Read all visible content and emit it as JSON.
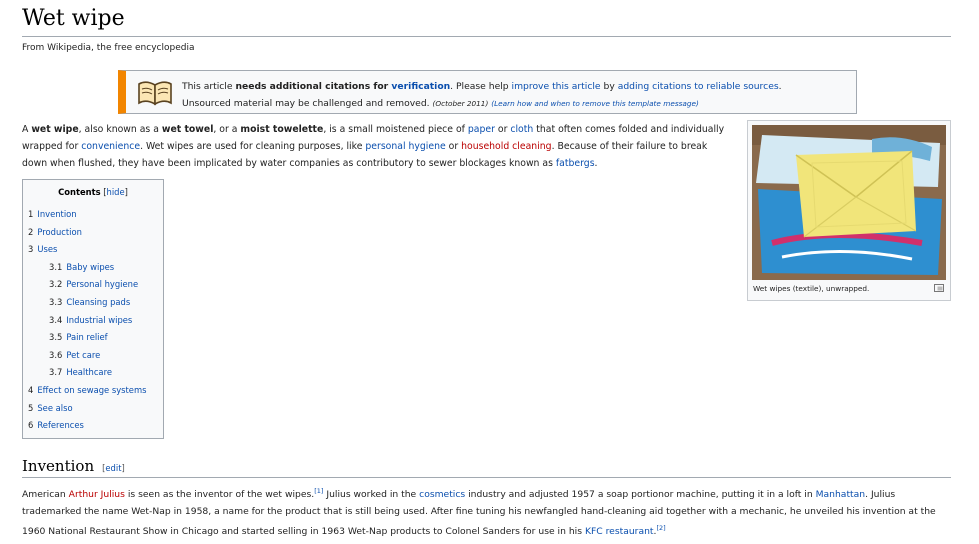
{
  "page": {
    "title": "Wet wipe",
    "tagline": "From Wikipedia, the free encyclopedia"
  },
  "ambox": {
    "icon": "book-icon",
    "t1": "This article ",
    "t2": "needs additional citations for ",
    "t3": "verification",
    "t4": ". Please help ",
    "t5": "improve this article",
    "t6": " by ",
    "t7": "adding citations to reliable sources",
    "t8": ".",
    "t9": "Unsourced material may be challenged and removed. ",
    "t10": "(October 2011)",
    "t11": "(Learn how and when to remove this template message)"
  },
  "intro": {
    "p1": "A ",
    "b1": "wet wipe",
    "p2": ", also known as a ",
    "b2": "wet towel",
    "p3": ", or a ",
    "b3": "moist towelette",
    "p4": ", is a small moistened piece of ",
    "l1": "paper",
    "p5": " or ",
    "l2": "cloth",
    "p6": " that often comes folded and individually wrapped for ",
    "l3": "convenience",
    "p7": ". Wet wipes are used for cleaning purposes, like ",
    "l4": "personal hygiene",
    "p8": " or ",
    "l5": "household cleaning",
    "p9": ". Because of their failure to break down when flushed, they have been implicated by water companies as contributory to sewer blockages known as ",
    "l6": "fatbergs",
    "p10": "."
  },
  "thumb": {
    "caption": "Wet wipes (textile), unwrapped.",
    "magnify_icon": "magnify-icon"
  },
  "toc": {
    "title": "Contents",
    "toggle": "hide",
    "items": [
      {
        "num": "1",
        "label": "Invention",
        "level": 1
      },
      {
        "num": "2",
        "label": "Production",
        "level": 1
      },
      {
        "num": "3",
        "label": "Uses",
        "level": 1
      },
      {
        "num": "3.1",
        "label": "Baby wipes",
        "level": 2
      },
      {
        "num": "3.2",
        "label": "Personal hygiene",
        "level": 2
      },
      {
        "num": "3.3",
        "label": "Cleansing pads",
        "level": 2
      },
      {
        "num": "3.4",
        "label": "Industrial wipes",
        "level": 2
      },
      {
        "num": "3.5",
        "label": "Pain relief",
        "level": 2
      },
      {
        "num": "3.6",
        "label": "Pet care",
        "level": 2
      },
      {
        "num": "3.7",
        "label": "Healthcare",
        "level": 2
      },
      {
        "num": "4",
        "label": "Effect on sewage systems",
        "level": 1
      },
      {
        "num": "5",
        "label": "See also",
        "level": 1
      },
      {
        "num": "6",
        "label": "References",
        "level": 1
      }
    ]
  },
  "invention": {
    "heading": "Invention",
    "edit": "edit",
    "s1": "American ",
    "l1": "Arthur Julius",
    "s2": " is seen as the inventor of the wet wipes.",
    "ref1": "[1]",
    "s3": " Julius worked in the ",
    "l2": "cosmetics",
    "s4": " industry and adjusted 1957 a soap portionor machine, putting it in a loft in ",
    "l3": "Manhattan",
    "s5": ". Julius trademarked the name Wet-Nap in 1958, a name for the product that is still being used. After fine tuning his newfangled hand-cleaning aid together with a mechanic, he unveiled his invention at the 1960 National Restaurant Show in Chicago and started selling in 1963 Wet-Nap products to Colonel Sanders for use in his ",
    "l4": "KFC restaurant",
    "s6": ".",
    "ref2": "[2]"
  },
  "colors": {
    "link": "#0b4fae",
    "redlink": "#ba0000",
    "ambox_border": "#f28500"
  }
}
